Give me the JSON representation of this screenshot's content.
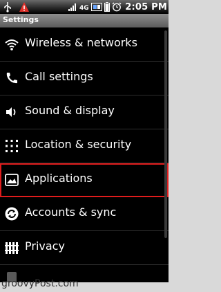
{
  "status_bar": {
    "network_badge": "4G",
    "time": "2:05 PM",
    "icons": [
      "usb-icon",
      "warning-icon",
      "signal-icon",
      "network-4g-icon",
      "sync-icon",
      "battery-icon",
      "alarm-icon"
    ]
  },
  "title_bar": {
    "title": "Settings"
  },
  "settings_items": [
    {
      "label": "Wireless & networks",
      "icon": "wifi-icon"
    },
    {
      "label": "Call settings",
      "icon": "phone-icon"
    },
    {
      "label": "Sound & display",
      "icon": "speaker-icon"
    },
    {
      "label": "Location & security",
      "icon": "location-grid-icon"
    },
    {
      "label": "Applications",
      "icon": "applications-icon",
      "highlighted": true
    },
    {
      "label": "Accounts & sync",
      "icon": "sync-icon"
    },
    {
      "label": "Privacy",
      "icon": "privacy-icon"
    }
  ],
  "watermark": "groovyPost.com",
  "colors": {
    "highlight_border": "#e01c1c",
    "warning": "#e0302a"
  }
}
